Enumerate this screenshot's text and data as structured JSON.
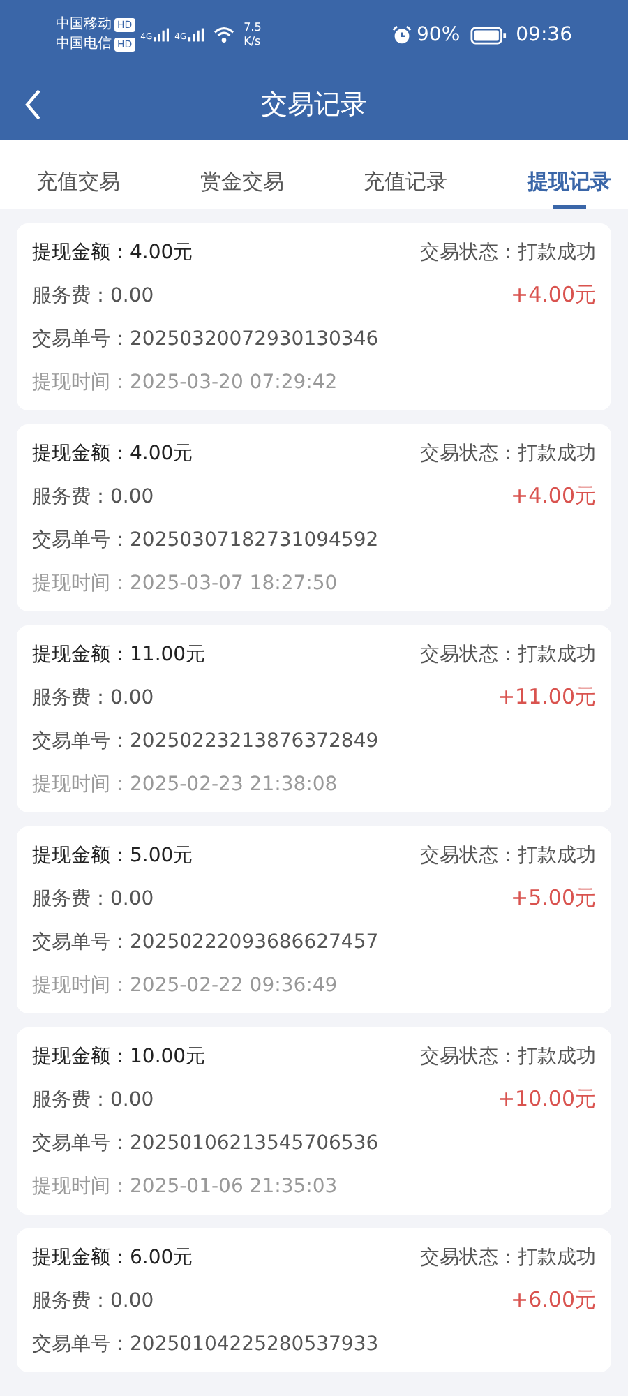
{
  "status_bar": {
    "carriers": [
      {
        "name": "中国移动",
        "badge": "HD"
      },
      {
        "name": "中国电信",
        "badge": "HD"
      }
    ],
    "networks": [
      "4G",
      "4G"
    ],
    "speed": "7.5",
    "speed_unit": "K/s",
    "battery": "90%",
    "time": "09:36"
  },
  "header": {
    "title": "交易记录"
  },
  "tabs": [
    {
      "label": "充值交易",
      "selected": false
    },
    {
      "label": "赏金交易",
      "selected": false
    },
    {
      "label": "充值记录",
      "selected": false
    },
    {
      "label": "提现记录",
      "selected": true
    }
  ],
  "records": [
    {
      "amount": "提现金额：4.00元",
      "status": "交易状态：打款成功",
      "fee": "服务费：0.00",
      "change": "+4.00元",
      "order": "交易单号：20250320072930130346",
      "time": "提现时间：2025-03-20 07:29:42"
    },
    {
      "amount": "提现金额：4.00元",
      "status": "交易状态：打款成功",
      "fee": "服务费：0.00",
      "change": "+4.00元",
      "order": "交易单号：20250307182731094592",
      "time": "提现时间：2025-03-07 18:27:50"
    },
    {
      "amount": "提现金额：11.00元",
      "status": "交易状态：打款成功",
      "fee": "服务费：0.00",
      "change": "+11.00元",
      "order": "交易单号：20250223213876372849",
      "time": "提现时间：2025-02-23 21:38:08"
    },
    {
      "amount": "提现金额：5.00元",
      "status": "交易状态：打款成功",
      "fee": "服务费：0.00",
      "change": "+5.00元",
      "order": "交易单号：20250222093686627457",
      "time": "提现时间：2025-02-22 09:36:49"
    },
    {
      "amount": "提现金额：10.00元",
      "status": "交易状态：打款成功",
      "fee": "服务费：0.00",
      "change": "+10.00元",
      "order": "交易单号：20250106213545706536",
      "time": "提现时间：2025-01-06 21:35:03"
    },
    {
      "amount": "提现金额：6.00元",
      "status": "交易状态：打款成功",
      "fee": "服务费：0.00",
      "change": "+6.00元",
      "order": "交易单号：20250104225280537933"
    }
  ]
}
